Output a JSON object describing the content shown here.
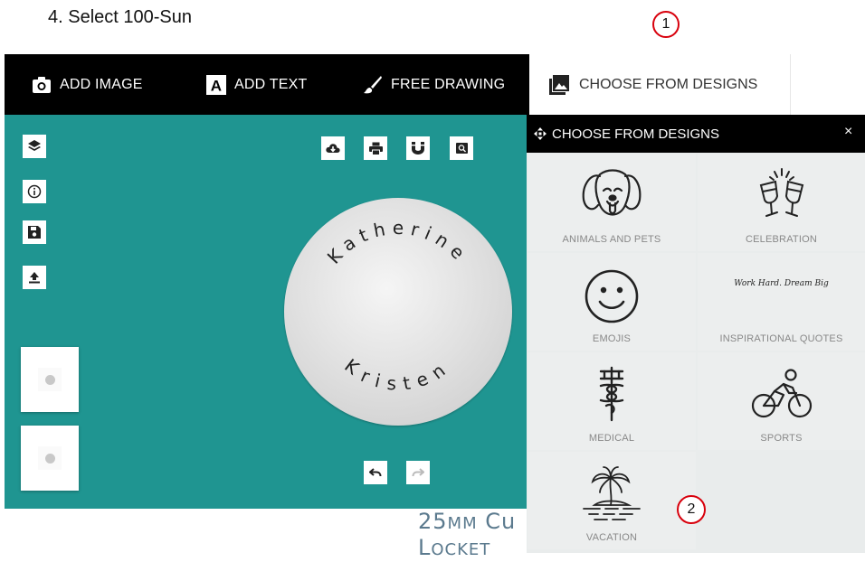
{
  "instruction": "4.   Select 100-Sun",
  "badges": {
    "one": "1",
    "two": "2"
  },
  "toolbar": {
    "add_image": "ADD IMAGE",
    "add_text": "ADD TEXT",
    "free_drawing": "FREE DRAWING",
    "choose_designs": "CHOOSE FROM DESIGNS"
  },
  "locket": {
    "top_text": "Katherine",
    "bottom_text": "Kristen"
  },
  "panel": {
    "title": "CHOOSE FROM DESIGNS",
    "close": "×",
    "categories": [
      {
        "label": "ANIMALS AND PETS",
        "icon": "dog-icon"
      },
      {
        "label": "CELEBRATION",
        "icon": "champagne-glasses-icon"
      },
      {
        "label": "EMOJIS",
        "icon": "smiley-icon"
      },
      {
        "label": "INSPIRATIONAL QUOTES",
        "icon": "quote-icon",
        "preview_text": "Work Hard. Dream Big"
      },
      {
        "label": "MEDICAL",
        "icon": "caduceus-icon"
      },
      {
        "label": "SPORTS",
        "icon": "cyclist-icon"
      },
      {
        "label": "VACATION",
        "icon": "palm-island-icon"
      }
    ]
  },
  "product_title": {
    "line1_big": "25",
    "line1_rest": "MM",
    "line1_word": " Cu",
    "line2_big": "L",
    "line2_rest": "OCKET"
  },
  "colors": {
    "canvas": "#1f9591",
    "toolbar": "#000000",
    "badge_border": "#d8000c",
    "panel": "#e9ecec"
  }
}
